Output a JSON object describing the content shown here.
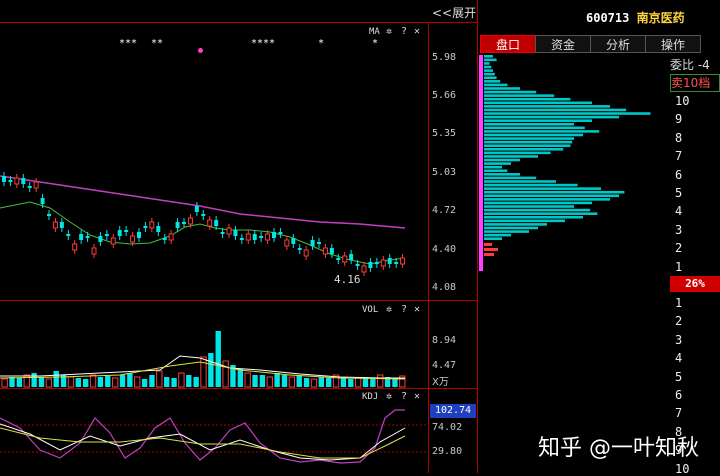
{
  "header": {
    "expand_label": "<<展开",
    "stock_code": "600713",
    "stock_name": "南京医药"
  },
  "main_panel": {
    "indicator_label": "MA",
    "y_ticks": [
      "5.98",
      "5.66",
      "5.35",
      "5.03",
      "4.72",
      "4.40",
      "4.08"
    ],
    "low_marker": "4.16",
    "star_markers": [
      "***",
      "**",
      "****",
      "*",
      "*"
    ]
  },
  "volume_panel": {
    "indicator_label": "VOL",
    "y_ticks": [
      "8.94",
      "4.47"
    ],
    "unit_label": "X万"
  },
  "kdj_panel": {
    "indicator_label": "KDJ",
    "value_badge": "102.74",
    "y_ticks": [
      "74.02",
      "29.80"
    ]
  },
  "controls": {
    "gear_icon": "✲",
    "help_icon": "?",
    "close_icon": "✕"
  },
  "tabs": [
    "盘口",
    "资金",
    "分析",
    "操作"
  ],
  "order_book": {
    "ratio_label": "委比  -4",
    "sell_label": "卖10档",
    "sell_levels": [
      "10",
      "9",
      "8",
      "7",
      "6",
      "5",
      "4",
      "3",
      "2",
      "1"
    ],
    "percent_badge": "26%",
    "buy_levels": [
      "1",
      "2",
      "3",
      "4",
      "5",
      "6",
      "7",
      "8",
      "9",
      "10"
    ]
  },
  "watermark": "知乎 @一叶知秋",
  "colors": {
    "background": "#000000",
    "grid": "#b00000",
    "rising": "#ff3b3b",
    "falling": "#00e5e5",
    "ma_long": "#c040c0",
    "ma_short": "#40c040",
    "accent": "#c00000"
  }
}
